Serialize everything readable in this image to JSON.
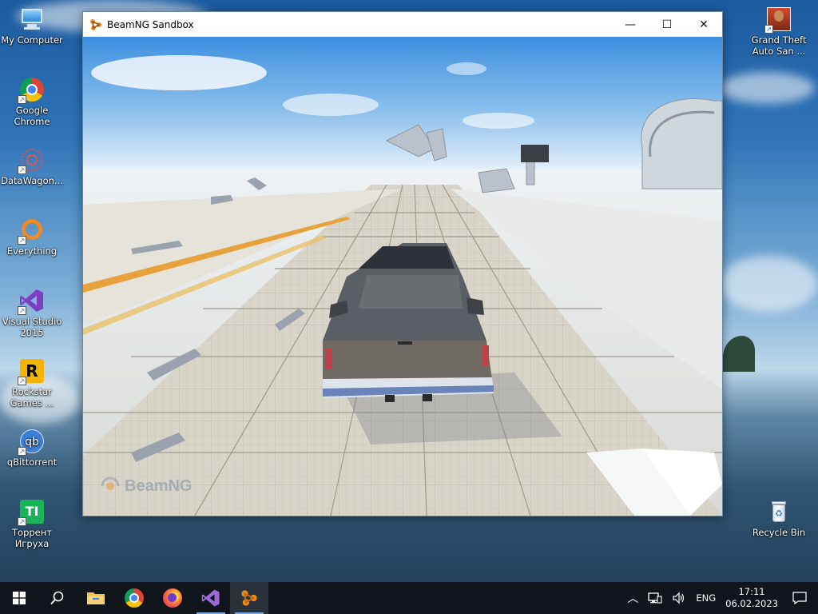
{
  "window": {
    "title": "BeamNG Sandbox",
    "minimize_glyph": "—",
    "maximize_glyph": "☐",
    "close_glyph": "✕"
  },
  "game": {
    "watermark": "BeamNG"
  },
  "desktop_icons": [
    {
      "label": "My Computer",
      "icon": "computer-icon"
    },
    {
      "label": "Google Chrome",
      "icon": "chrome-icon"
    },
    {
      "label": "DataWagon...",
      "icon": "datawagon-icon"
    },
    {
      "label": "Everything",
      "icon": "everything-icon"
    },
    {
      "label": "Visual Studio 2015",
      "icon": "visual-studio-icon"
    },
    {
      "label": "Rockstar Games ...",
      "icon": "rockstar-icon"
    },
    {
      "label": "qBittorrent",
      "icon": "qbittorrent-icon"
    },
    {
      "label": "Торрент Игруха",
      "icon": "torrent-igruha-icon"
    },
    {
      "label": "Grand Theft Auto San ...",
      "icon": "gta-icon"
    },
    {
      "label": "Recycle Bin",
      "icon": "recycle-bin-icon"
    }
  ],
  "taskbar": {
    "items": [
      "start-icon",
      "search-icon",
      "file-explorer-icon",
      "chrome-icon",
      "firefox-icon",
      "visual-studio-icon",
      "beamng-icon"
    ],
    "tray": {
      "language": "ENG",
      "time": "17:11",
      "date": "06.02.2023"
    }
  },
  "colors": {
    "taskbar_bg": "#10141b",
    "accent": "#7aa7dc"
  }
}
